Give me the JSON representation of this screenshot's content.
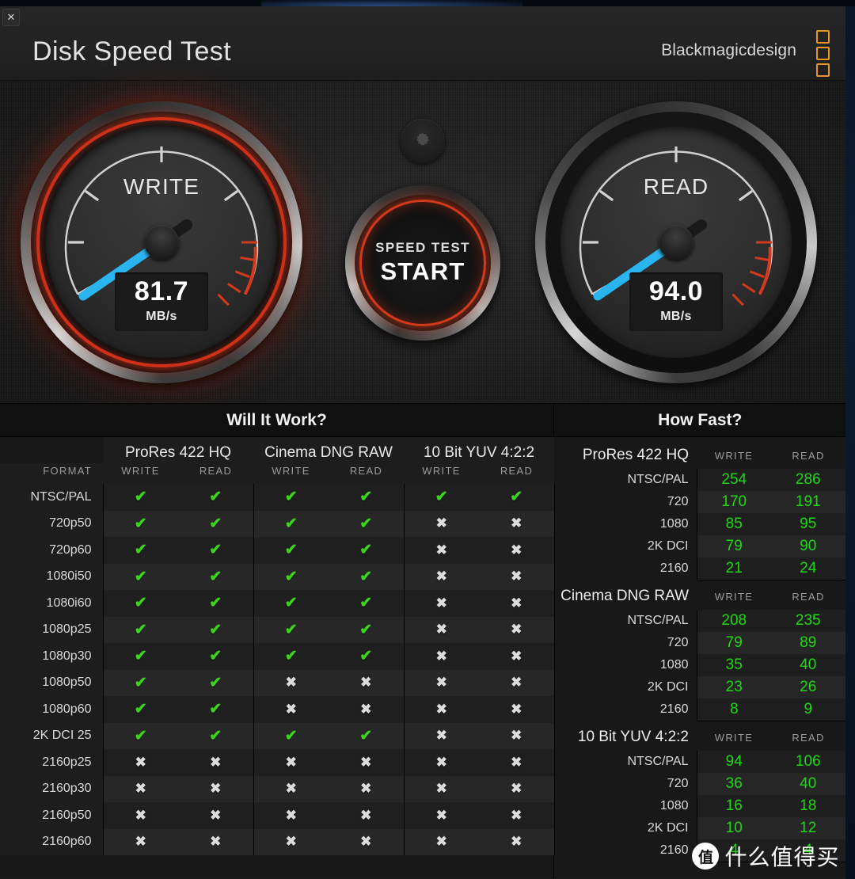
{
  "titlebar": {
    "close_label": "✕",
    "app_title": "Disk Speed Test",
    "brand": "Blackmagicdesign"
  },
  "gauges": {
    "write": {
      "label": "WRITE",
      "value": "81.7",
      "unit": "MB/s"
    },
    "read": {
      "label": "READ",
      "value": "94.0",
      "unit": "MB/s"
    }
  },
  "center": {
    "gear_icon": "gear-icon",
    "start_top": "SPEED TEST",
    "start_big": "START"
  },
  "will_it_work": {
    "title": "Will It Work?",
    "format_header": "FORMAT",
    "groups": [
      "ProRes 422 HQ",
      "Cinema DNG RAW",
      "10 Bit YUV 4:2:2"
    ],
    "sub_headers": [
      "WRITE",
      "READ"
    ],
    "ok_glyph": "✔",
    "no_glyph": "✖",
    "rows": [
      {
        "format": "NTSC/PAL",
        "cells": [
          true,
          true,
          true,
          true,
          true,
          true
        ]
      },
      {
        "format": "720p50",
        "cells": [
          true,
          true,
          true,
          true,
          false,
          false
        ]
      },
      {
        "format": "720p60",
        "cells": [
          true,
          true,
          true,
          true,
          false,
          false
        ]
      },
      {
        "format": "1080i50",
        "cells": [
          true,
          true,
          true,
          true,
          false,
          false
        ]
      },
      {
        "format": "1080i60",
        "cells": [
          true,
          true,
          true,
          true,
          false,
          false
        ]
      },
      {
        "format": "1080p25",
        "cells": [
          true,
          true,
          true,
          true,
          false,
          false
        ]
      },
      {
        "format": "1080p30",
        "cells": [
          true,
          true,
          true,
          true,
          false,
          false
        ]
      },
      {
        "format": "1080p50",
        "cells": [
          true,
          true,
          false,
          false,
          false,
          false
        ]
      },
      {
        "format": "1080p60",
        "cells": [
          true,
          true,
          false,
          false,
          false,
          false
        ]
      },
      {
        "format": "2K DCI 25",
        "cells": [
          true,
          true,
          true,
          true,
          false,
          false
        ]
      },
      {
        "format": "2160p25",
        "cells": [
          false,
          false,
          false,
          false,
          false,
          false
        ]
      },
      {
        "format": "2160p30",
        "cells": [
          false,
          false,
          false,
          false,
          false,
          false
        ]
      },
      {
        "format": "2160p50",
        "cells": [
          false,
          false,
          false,
          false,
          false,
          false
        ]
      },
      {
        "format": "2160p60",
        "cells": [
          false,
          false,
          false,
          false,
          false,
          false
        ]
      }
    ]
  },
  "how_fast": {
    "title": "How Fast?",
    "col_headers": [
      "WRITE",
      "READ"
    ],
    "sections": [
      {
        "name": "ProRes 422 HQ",
        "rows": [
          {
            "label": "NTSC/PAL",
            "write": "254",
            "read": "286"
          },
          {
            "label": "720",
            "write": "170",
            "read": "191"
          },
          {
            "label": "1080",
            "write": "85",
            "read": "95"
          },
          {
            "label": "2K DCI",
            "write": "79",
            "read": "90"
          },
          {
            "label": "2160",
            "write": "21",
            "read": "24"
          }
        ]
      },
      {
        "name": "Cinema DNG RAW",
        "rows": [
          {
            "label": "NTSC/PAL",
            "write": "208",
            "read": "235"
          },
          {
            "label": "720",
            "write": "79",
            "read": "89"
          },
          {
            "label": "1080",
            "write": "35",
            "read": "40"
          },
          {
            "label": "2K DCI",
            "write": "23",
            "read": "26"
          },
          {
            "label": "2160",
            "write": "8",
            "read": "9"
          }
        ]
      },
      {
        "name": "10 Bit YUV 4:2:2",
        "rows": [
          {
            "label": "NTSC/PAL",
            "write": "94",
            "read": "106"
          },
          {
            "label": "720",
            "write": "36",
            "read": "40"
          },
          {
            "label": "1080",
            "write": "16",
            "read": "18"
          },
          {
            "label": "2K DCI",
            "write": "10",
            "read": "12"
          },
          {
            "label": "2160",
            "write": "4",
            "read": "4"
          }
        ]
      }
    ]
  },
  "watermark": {
    "badge": "值",
    "text": "什么值得买"
  }
}
